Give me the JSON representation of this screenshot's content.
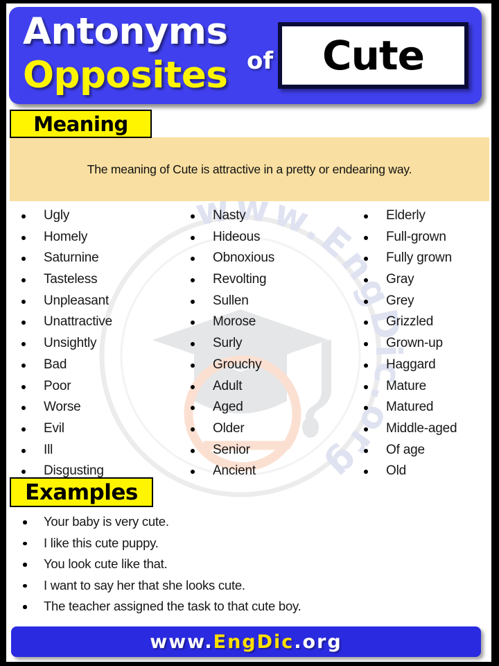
{
  "header": {
    "title_line1": "Antonyms",
    "title_line2": "Opposites",
    "connector": "of",
    "word": "Cute"
  },
  "meaning": {
    "label": "Meaning",
    "text": "The meaning of Cute is attractive in a pretty or endearing way."
  },
  "antonyms": {
    "columns": [
      {
        "items": [
          "Ugly",
          "Homely",
          "Saturnine",
          "Tasteless",
          "Unpleasant",
          "Unattractive",
          "Unsightly",
          "Bad",
          "Poor",
          "Worse",
          "Evil",
          "Ill",
          "Disgusting"
        ]
      },
      {
        "items": [
          "Nasty",
          "Hideous",
          "Obnoxious",
          "Revolting",
          "Sullen",
          "Morose",
          "Surly",
          "Grouchy",
          "Adult",
          "Aged",
          "Older",
          "Senior",
          "Ancient"
        ]
      },
      {
        "items": [
          "Elderly",
          "Full-grown",
          "Fully grown",
          "Gray",
          "Grey",
          "Grizzled",
          "Grown-up",
          "Haggard",
          "Mature",
          "Matured",
          "Middle-aged",
          "Of age",
          "Old"
        ]
      }
    ]
  },
  "examples": {
    "label": "Examples",
    "items": [
      "Your baby is very cute.",
      "I like this cute puppy.",
      "You look cute like that.",
      "I want to say her that she looks cute.",
      "The teacher assigned the task to that cute boy."
    ]
  },
  "footer": {
    "prefix": "www.",
    "brand": "EngDic",
    "suffix": ".org"
  },
  "watermark": {
    "ring_text": "www.EngDic.org",
    "logo": "graduation-cap"
  },
  "colors": {
    "banner_blue": "#4040EE",
    "footer_blue": "#2A2AE0",
    "accent_yellow": "#FFF500",
    "meaning_bg": "#F9DFA1",
    "frame_black": "#000000"
  }
}
